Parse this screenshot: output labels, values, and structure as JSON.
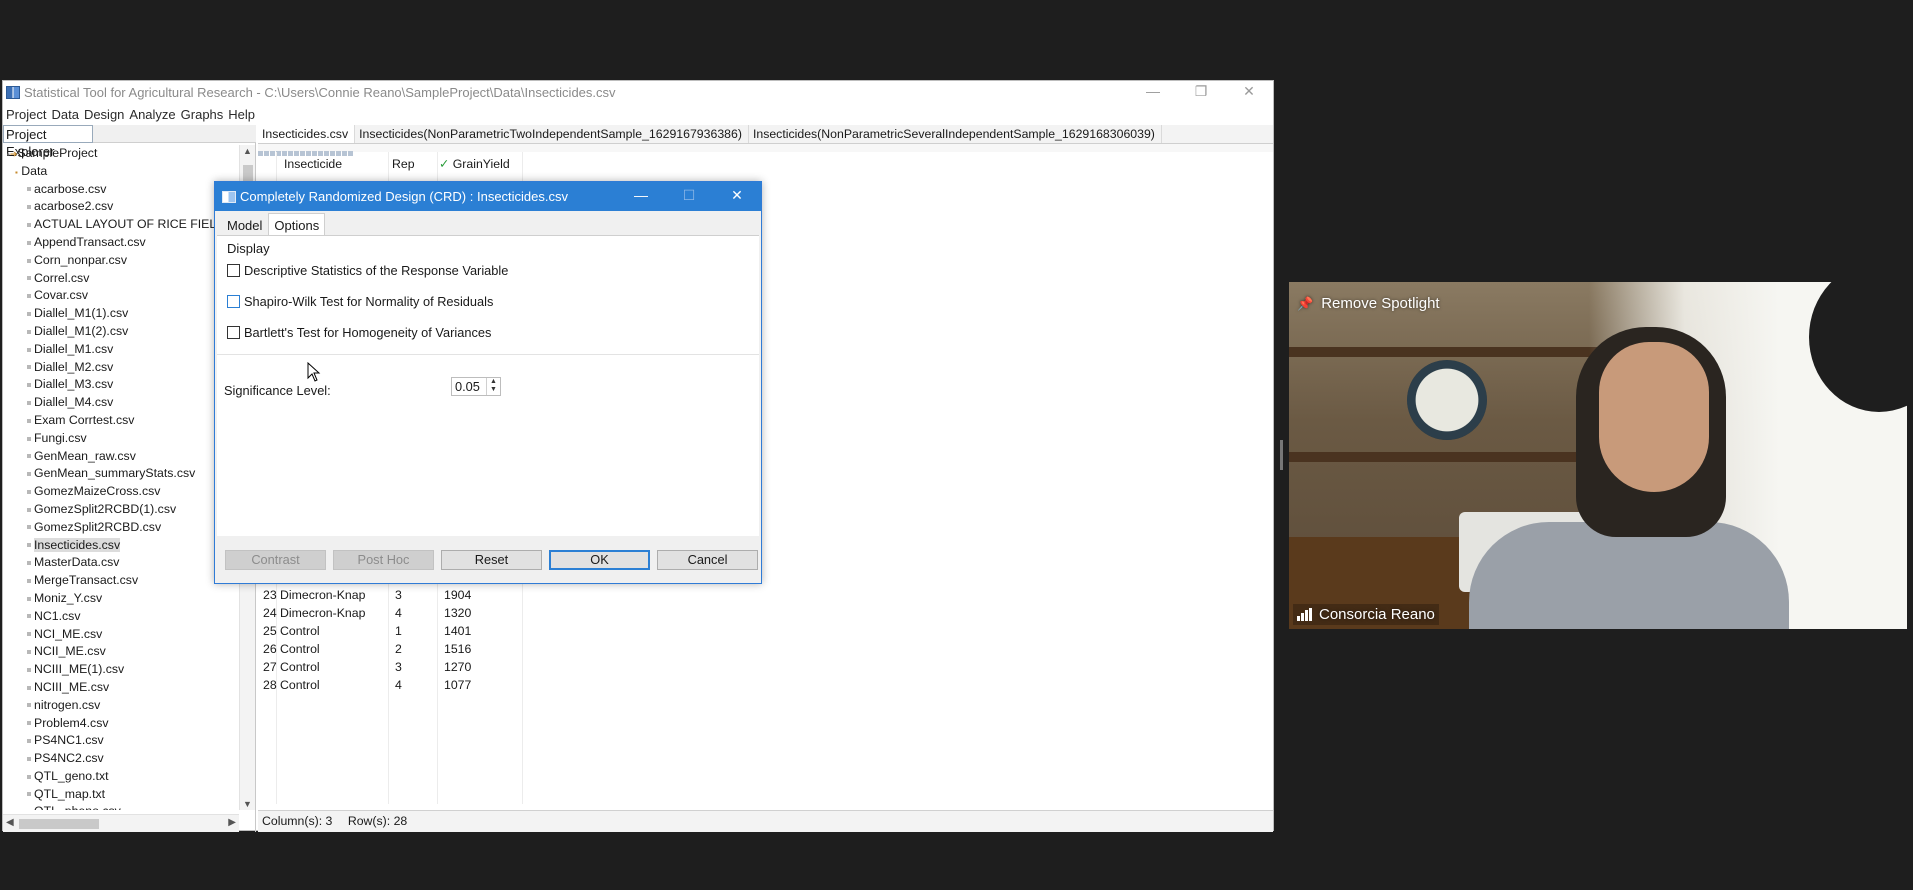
{
  "app": {
    "title": "Statistical Tool for Agricultural Research - C:\\Users\\Connie Reano\\SampleProject\\Data\\Insecticides.csv",
    "window_controls": {
      "minimize": "—",
      "restore": "❐",
      "close": "✕"
    },
    "menu": [
      "Project",
      "Data",
      "Design",
      "Analyze",
      "Graphs",
      "Help"
    ]
  },
  "explorer": {
    "title": "Project Explorer",
    "root": "SampleProject",
    "folder": "Data",
    "selected": "Insecticides.csv",
    "files": [
      "acarbose.csv",
      "acarbose2.csv",
      "ACTUAL LAYOUT OF RICE FIELD.c",
      "AppendTransact.csv",
      "Corn_nonpar.csv",
      "Correl.csv",
      "Covar.csv",
      "Diallel_M1(1).csv",
      "Diallel_M1(2).csv",
      "Diallel_M1.csv",
      "Diallel_M2.csv",
      "Diallel_M3.csv",
      "Diallel_M4.csv",
      "Exam Corrtest.csv",
      "Fungi.csv",
      "GenMean_raw.csv",
      "GenMean_summaryStats.csv",
      "GomezMaizeCross.csv",
      "GomezSplit2RCBD(1).csv",
      "GomezSplit2RCBD.csv",
      "Insecticides.csv",
      "MasterData.csv",
      "MergeTransact.csv",
      "Moniz_Y.csv",
      "NC1.csv",
      "NCI_ME.csv",
      "NCII_ME.csv",
      "NCIII_ME(1).csv",
      "NCIII_ME.csv",
      "nitrogen.csv",
      "Problem4.csv",
      "PS4NC1.csv",
      "PS4NC2.csv",
      "QTL_geno.txt",
      "QTL_map.txt",
      "QTL_pheno.csv"
    ]
  },
  "editor": {
    "tabs": [
      "Insecticides.csv",
      "Insecticides(NonParametricTwoIndependentSample_1629167936386)",
      "Insecticides(NonParametricSeveralIndependentSample_1629168306039)"
    ],
    "columns": [
      "Insecticide",
      "Rep",
      "GrainYield"
    ],
    "grainyield_check": "✓",
    "rows": [
      {
        "n": "23",
        "insecticide": "Dimecron-Knap",
        "rep": "3",
        "yield": "1904"
      },
      {
        "n": "24",
        "insecticide": "Dimecron-Knap",
        "rep": "4",
        "yield": "1320"
      },
      {
        "n": "25",
        "insecticide": "Control",
        "rep": "1",
        "yield": "1401"
      },
      {
        "n": "26",
        "insecticide": "Control",
        "rep": "2",
        "yield": "1516"
      },
      {
        "n": "27",
        "insecticide": "Control",
        "rep": "3",
        "yield": "1270"
      },
      {
        "n": "28",
        "insecticide": "Control",
        "rep": "4",
        "yield": "1077"
      }
    ],
    "status": {
      "columns": "Column(s): 3",
      "rows": "Row(s): 28"
    }
  },
  "dialog": {
    "title": "Completely Randomized Design (CRD) : Insecticides.csv",
    "controls": {
      "minimize": "—",
      "maximize": "☐",
      "close": "✕"
    },
    "tabs": {
      "model": "Model",
      "options": "Options"
    },
    "active_tab": "Options",
    "display_label": "Display",
    "checkboxes": {
      "descriptive": "Descriptive Statistics of the Response Variable",
      "shapiro": "Shapiro-Wilk Test for Normality of Residuals",
      "bartlett": "Bartlett's Test for Homogeneity of Variances"
    },
    "significance_label": "Significance Level:",
    "significance_value": "0.05",
    "spinner_arrows": {
      "up": "▲",
      "down": "▼"
    },
    "buttons": {
      "contrast": "Contrast",
      "posthoc": "Post Hoc",
      "reset": "Reset",
      "ok": "OK",
      "cancel": "Cancel"
    }
  },
  "video": {
    "spotlight_label": "Remove Spotlight",
    "pin_icon": "📌",
    "participant_name": "Consorcia Reano"
  },
  "glyphs": {
    "triangle_up": "▲",
    "triangle_down": "▼",
    "arrow_left": "◀",
    "arrow_right": "▶"
  }
}
